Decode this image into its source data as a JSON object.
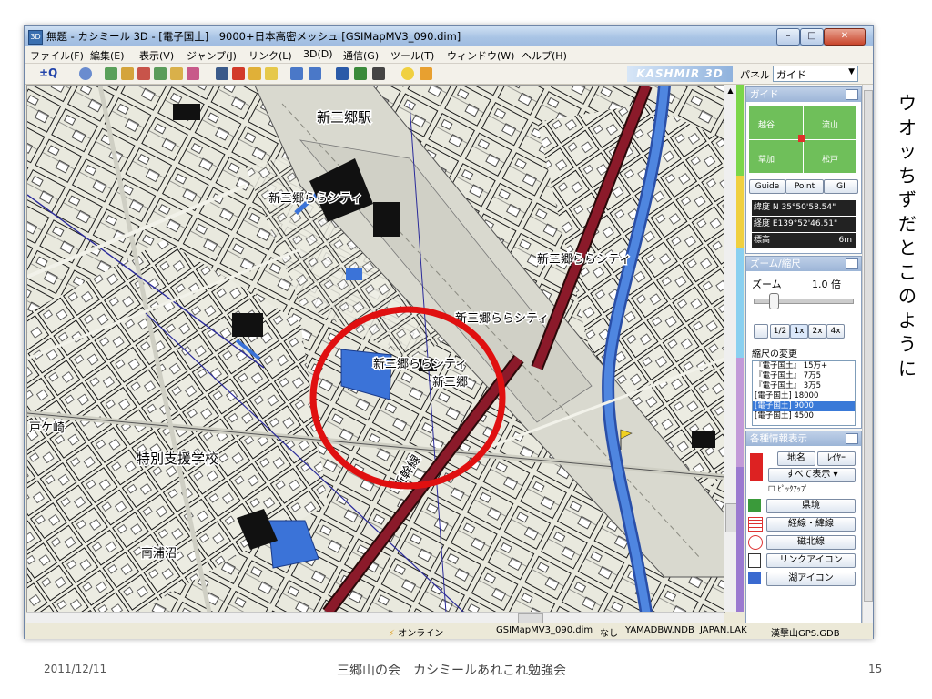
{
  "window": {
    "app_icon_text": "3D",
    "title": "無題 - カシミール 3D - [電子国土]　9000+日本高密メッシュ [GSIMapMV3_090.dim]",
    "minimize": "–",
    "maximize": "□",
    "close": "✕"
  },
  "menu": [
    "ファイル(F)",
    "編集(E)",
    "表示(V)",
    "ジャンプ(J)",
    "リンク(L)",
    "3D(D)",
    "通信(G)",
    "ツール(T)",
    "ウィンドウ(W)",
    "ヘルプ(H)"
  ],
  "toolbar": {
    "brand": "KASHMIR 3D",
    "zoom_label": "±Q",
    "icons": [
      "zoom-icon",
      "hand-icon",
      "layer1-icon",
      "layer2-icon",
      "layer3-icon",
      "layer4-icon",
      "layer5-icon",
      "layer6-icon",
      "binoculars-icon",
      "flag-icon",
      "pen-icon",
      "ruler-icon",
      "back-icon",
      "forward-icon",
      "camera-icon",
      "print-icon",
      "save-icon",
      "help-icon",
      "info-icon"
    ]
  },
  "panel": {
    "label": "パネル",
    "select_value": "ガイド"
  },
  "map": {
    "labels": [
      "新三郷駅",
      "新三郷ららシティ",
      "新三郷ららシティ",
      "新三郷ららシティ",
      "新三郷ららシティ",
      "新三郷",
      "特別支援学校",
      "新幹線",
      "南浦沼",
      "戸ケ崎"
    ]
  },
  "guide": {
    "header": "ガイド",
    "places": [
      "越谷",
      "流山",
      "草加",
      "松戸"
    ],
    "tabs": [
      "Guide",
      "Point",
      "GI"
    ],
    "lat_label": "緯度",
    "lat_value": "N 35°50'58.54\"",
    "lon_label": "経度",
    "lon_value": "E139°52'46.51\"",
    "alt_label": "標高",
    "alt_value": "6m"
  },
  "zoom": {
    "header": "ズーム/縮尺",
    "zoom_label": "ズーム",
    "zoom_value": "1.0 倍",
    "zoom_level": 0.15,
    "buttons": [
      "1/2",
      "1x",
      "2x",
      "4x"
    ],
    "scale_change_label": "縮尺の変更",
    "scales": [
      "『電子国土』 15万+",
      "『電子国土』 7万5",
      "『電子国土』 3万5",
      "[電子国土] 18000",
      "[電子国土] 9000",
      "[電子国土] 4500"
    ],
    "selected_scale_index": 4
  },
  "info": {
    "header": "各種情報表示",
    "place_name": "地名",
    "layer": "ﾚｲﾔｰ",
    "show_all": "すべて表示",
    "pickup": "ﾋﾟｯｸｱｯﾌﾟ",
    "items": [
      "県境",
      "経線・緯線",
      "磁北線",
      "リンクアイコン",
      "湖アイコン"
    ]
  },
  "status": {
    "online": "オンライン",
    "map_file": "GSIMapMV3_090.dim",
    "none": "なし",
    "yama": "YAMADBW.NDB",
    "japan": "JAPAN.LAK",
    "gps": "漢撃山GPS.GDB"
  },
  "caption": [
    "ウ",
    "オ",
    "ッ",
    "ち",
    "ず",
    "だ",
    "と",
    "こ",
    "の",
    "よ",
    "う",
    "に"
  ],
  "footer": {
    "date": "2011/12/11",
    "center": "三郷山の会　カシミールあれこれ勉強会",
    "page": "15"
  },
  "colors": {
    "railway": "#8b1a2a",
    "river": "#3b73d8",
    "highlight_circle": "#e01010",
    "road": "#d9d9d0",
    "map_bg": "#eaeadf"
  }
}
